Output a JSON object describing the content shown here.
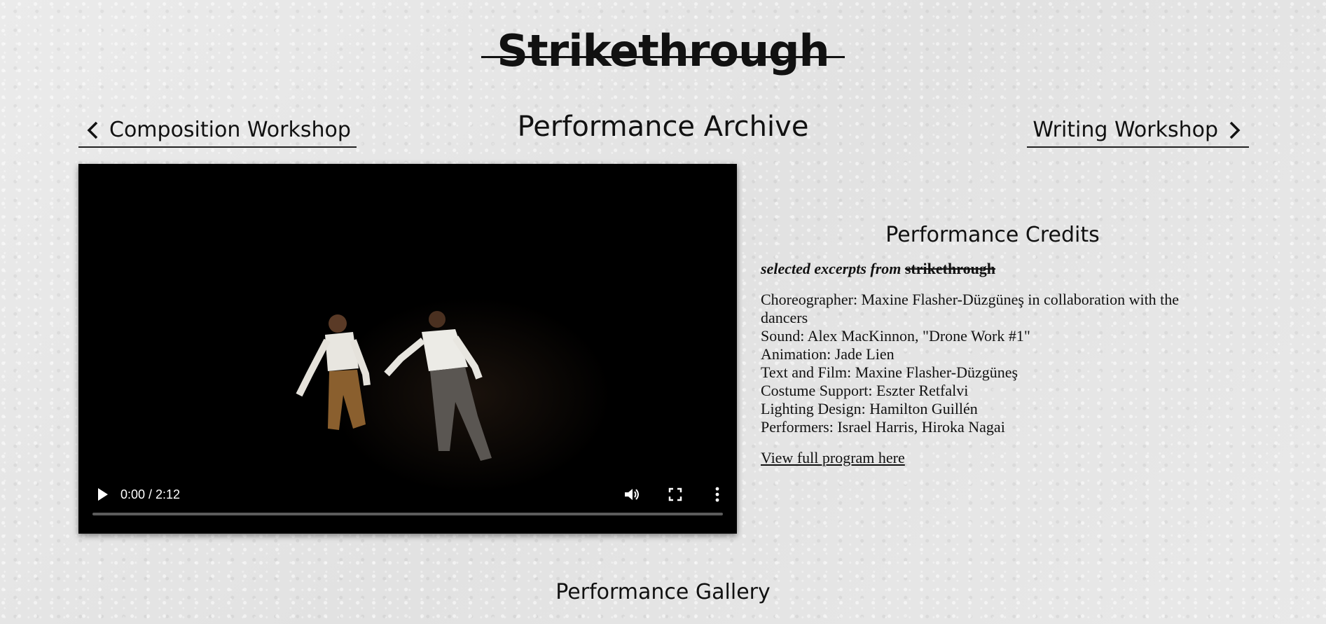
{
  "site": {
    "title": "Strikethrough"
  },
  "nav": {
    "prev_label": "Composition Workshop",
    "next_label": "Writing Workshop"
  },
  "page": {
    "heading": "Performance Archive"
  },
  "video": {
    "time": "0:00 / 2:12",
    "progress": 0
  },
  "credits": {
    "title": "Performance Credits",
    "excerpt_prefix": "selected excerpts from",
    "excerpt_struck": "strikethrough",
    "lines": [
      "Choreographer: Maxine Flasher-Düzgüneş in collaboration with the dancers",
      "Sound: Alex MacKinnon, \"Drone Work #1\"",
      "Animation: Jade Lien",
      "Text and Film: Maxine Flasher-Düzgüneş",
      "Costume Support: Eszter Retfalvi",
      "Lighting Design: Hamilton Guillén",
      "Performers: Israel Harris, Hiroka Nagai"
    ],
    "program_link": "View full program here"
  },
  "gallery": {
    "heading": "Performance Gallery"
  }
}
